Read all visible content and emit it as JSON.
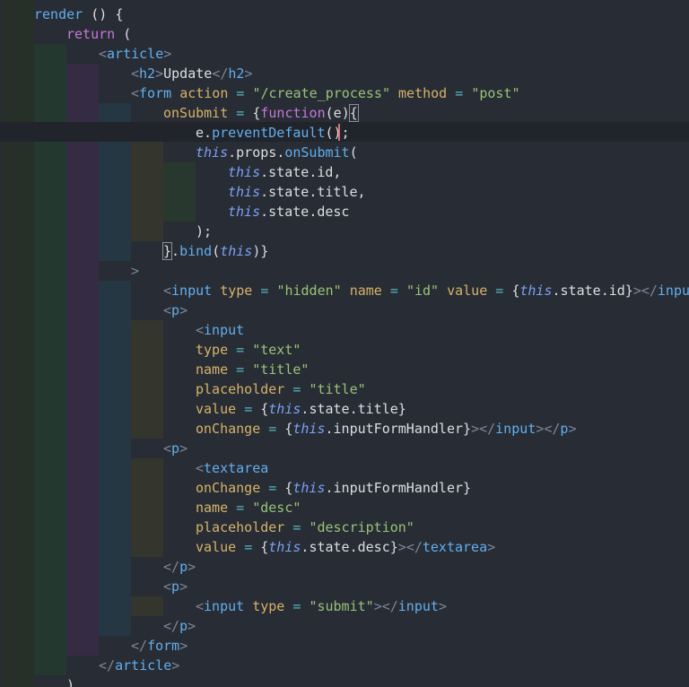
{
  "editor": {
    "lines": [
      "render () {",
      "return (",
      "<article>",
      "<h2>Update</h2>",
      "<form action = \"/create_process\" method = \"post\"",
      "onSubmit = {function(e){",
      "e.preventDefault();",
      "this.props.onSubmit(",
      "this.state.id,",
      "this.state.title,",
      "this.state.desc",
      ");",
      "}.bind(this)}",
      ">",
      "<input type = \"hidden\" name = \"id\" value = {this.state.id}></input>",
      "<p>",
      "<input",
      "type = \"text\"",
      "name = \"title\"",
      "placeholder = \"title\"",
      "value = {this.state.title}",
      "onChange = {this.inputFormHandler}></input></p>",
      "<p>",
      "<textarea",
      "onChange = {this.inputFormHandler}",
      "name = \"desc\"",
      "placeholder = \"description\"",
      "value = {this.state.desc}></textarea>",
      "</p>",
      "<p>",
      "<input type = \"submit\"></input>",
      "</p>",
      "</form>",
      "</article>",
      ")"
    ]
  },
  "theme": {
    "background": "#282c34",
    "cursor_color": "#e06c75",
    "colors": {
      "keyword": "#c678dd",
      "tag": "#61afef",
      "attribute": "#d6b36a",
      "string": "#98c379",
      "this": "#7aa2f7"
    }
  }
}
